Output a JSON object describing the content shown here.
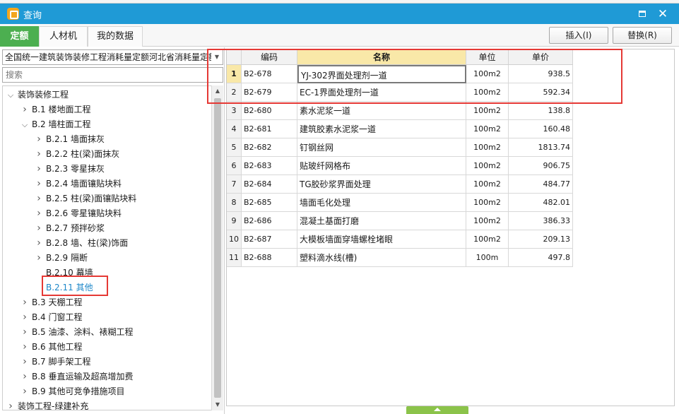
{
  "window": {
    "title": "查询"
  },
  "tabs": [
    {
      "label": "定额",
      "active": true
    },
    {
      "label": "人材机",
      "active": false
    },
    {
      "label": "我的数据",
      "active": false
    }
  ],
  "actions": {
    "insert": "插入(I)",
    "replace": "替换(R)"
  },
  "library": {
    "selected": "全国统一建筑装饰装修工程消耗量定额河北省消耗量定额"
  },
  "search": {
    "placeholder": "搜索",
    "value": ""
  },
  "tree": [
    {
      "label": "装饰装修工程",
      "level": 0,
      "expanded": true
    },
    {
      "label": "B.1 楼地面工程",
      "level": 1,
      "expanded": false
    },
    {
      "label": "B.2 墙柱面工程",
      "level": 1,
      "expanded": true
    },
    {
      "label": "B.2.1 墙面抹灰",
      "level": 2,
      "expanded": false
    },
    {
      "label": "B.2.2 柱(梁)面抹灰",
      "level": 2,
      "expanded": false
    },
    {
      "label": "B.2.3 零星抹灰",
      "level": 2,
      "expanded": false
    },
    {
      "label": "B.2.4 墙面镶贴块料",
      "level": 2,
      "expanded": false
    },
    {
      "label": "B.2.5 柱(梁)面镶贴块料",
      "level": 2,
      "expanded": false
    },
    {
      "label": "B.2.6 零星镶贴块料",
      "level": 2,
      "expanded": false
    },
    {
      "label": "B.2.7 预拌砂浆",
      "level": 2,
      "expanded": false
    },
    {
      "label": "B.2.8 墙、柱(梁)饰面",
      "level": 2,
      "expanded": false
    },
    {
      "label": "B.2.9 隔断",
      "level": 2,
      "expanded": false
    },
    {
      "label": "B.2.10 幕墙",
      "level": 2,
      "leaf": true
    },
    {
      "label": "B.2.11 其他",
      "level": 2,
      "leaf": true,
      "selected": true
    },
    {
      "label": "B.3 天棚工程",
      "level": 1,
      "expanded": false
    },
    {
      "label": "B.4 门窗工程",
      "level": 1,
      "expanded": false
    },
    {
      "label": "B.5 油漆、涂料、裱糊工程",
      "level": 1,
      "expanded": false
    },
    {
      "label": "B.6 其他工程",
      "level": 1,
      "expanded": false
    },
    {
      "label": "B.7 脚手架工程",
      "level": 1,
      "expanded": false
    },
    {
      "label": "B.8 垂直运输及超高增加费",
      "level": 1,
      "expanded": false
    },
    {
      "label": "B.9 其他可竞争措施项目",
      "level": 1,
      "expanded": false
    },
    {
      "label": "装饰工程-绿建补充",
      "level": 0,
      "expanded": false
    }
  ],
  "grid": {
    "columns": [
      "编码",
      "名称",
      "单位",
      "单价"
    ],
    "rows": [
      {
        "no": "1",
        "code": "B2-678",
        "name": "YJ-302界面处理剂一道",
        "unit": "100m2",
        "price": "938.5"
      },
      {
        "no": "2",
        "code": "B2-679",
        "name": "EC-1界面处理剂一道",
        "unit": "100m2",
        "price": "592.34"
      },
      {
        "no": "3",
        "code": "B2-680",
        "name": "素水泥浆一道",
        "unit": "100m2",
        "price": "138.8"
      },
      {
        "no": "4",
        "code": "B2-681",
        "name": "建筑胶素水泥浆一道",
        "unit": "100m2",
        "price": "160.48"
      },
      {
        "no": "5",
        "code": "B2-682",
        "name": "钉钢丝网",
        "unit": "100m2",
        "price": "1813.74"
      },
      {
        "no": "6",
        "code": "B2-683",
        "name": "贴玻纤网格布",
        "unit": "100m2",
        "price": "906.75"
      },
      {
        "no": "7",
        "code": "B2-684",
        "name": "TG胶砂浆界面处理",
        "unit": "100m2",
        "price": "484.77"
      },
      {
        "no": "8",
        "code": "B2-685",
        "name": "墙面毛化处理",
        "unit": "100m2",
        "price": "482.01"
      },
      {
        "no": "9",
        "code": "B2-686",
        "name": "混凝土基面打磨",
        "unit": "100m2",
        "price": "386.33"
      },
      {
        "no": "10",
        "code": "B2-687",
        "name": "大模板墙面穿墙螺栓堵眼",
        "unit": "100m2",
        "price": "209.13"
      },
      {
        "no": "11",
        "code": "B2-688",
        "name": "塑料滴水线(槽)",
        "unit": "100m",
        "price": "497.8"
      }
    ]
  },
  "colors": {
    "titlebar": "#1f9ad6",
    "activeTab": "#4caf50",
    "highlight": "#e53935",
    "selectedHeader": "#f9e8a8",
    "selectedTreeText": "#1e88c9"
  }
}
